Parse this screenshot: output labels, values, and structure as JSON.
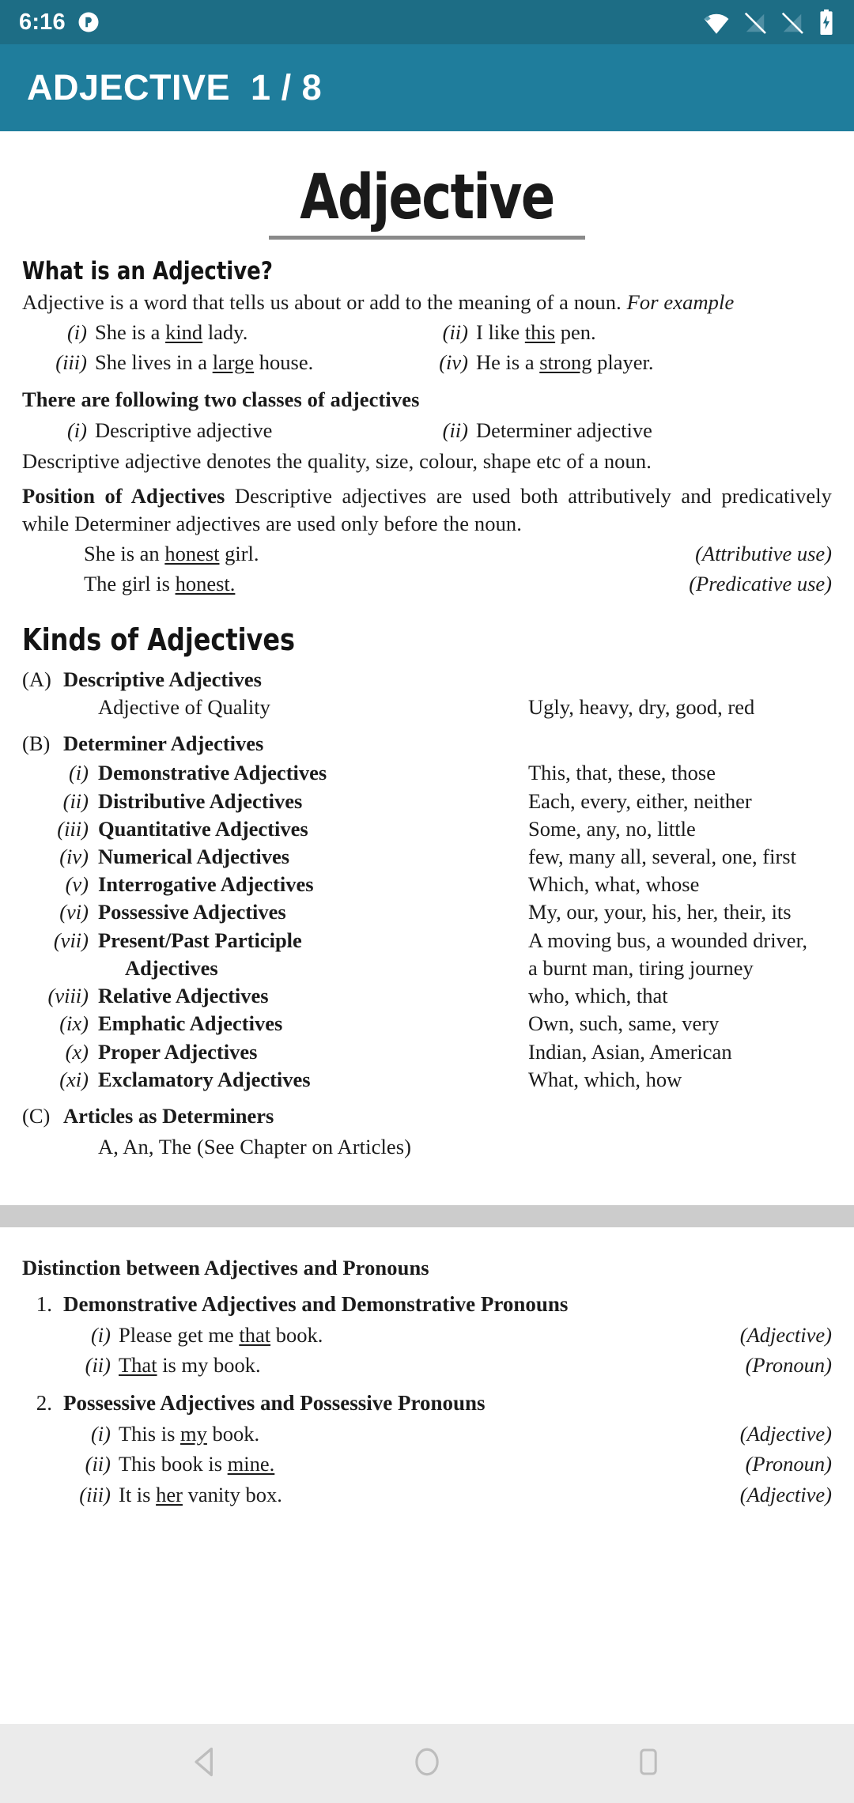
{
  "status_bar": {
    "time": "6:16",
    "icons": [
      "do-not-disturb-icon",
      "wifi-icon",
      "no-sim-1-icon",
      "no-sim-2-icon",
      "battery-charging-icon"
    ],
    "background_color": "#1d6d85"
  },
  "app_bar": {
    "title": "ADJECTIVE  1 / 8",
    "background_color": "#1f7d9c"
  },
  "document": {
    "title": "Adjective",
    "section_what_is": {
      "heading": "What is an Adjective?",
      "intro_plain": "Adjective is a word that tells us about or add to the meaning of a noun. ",
      "intro_italic": "For example",
      "examples": [
        {
          "num": "(i)",
          "pre": "She is a ",
          "u": "kind",
          "post": " lady."
        },
        {
          "num": "(ii)",
          "pre": "I like ",
          "u": "this",
          "post": " pen."
        },
        {
          "num": "(iii)",
          "pre": "She lives in a ",
          "u": "large",
          "post": " house."
        },
        {
          "num": "(iv)",
          "pre": "He is a ",
          "u": "strong",
          "post": " player."
        }
      ]
    },
    "section_classes": {
      "heading": "There are following two classes of adjectives",
      "items": [
        {
          "num": "(i)",
          "text": "Descriptive adjective"
        },
        {
          "num": "(ii)",
          "text": "Determiner adjective"
        }
      ],
      "note": "Descriptive adjective denotes the quality, size, colour, shape etc of a noun."
    },
    "section_position": {
      "lead": "Position of Adjectives",
      "body": " Descriptive adjectives are used both attributively and predicatively while Determiner adjectives are used only before the noun.",
      "examples": [
        {
          "pre": "She is an ",
          "u": "honest",
          "post": " girl.",
          "tag": "(Attributive use)"
        },
        {
          "pre": "The girl is ",
          "u": "honest.",
          "post": "",
          "tag": "(Predicative use)"
        }
      ]
    },
    "section_kinds": {
      "heading": "Kinds of Adjectives",
      "group_a": {
        "letter": "(A)",
        "title": "Descriptive Adjectives",
        "rows": [
          {
            "label": "Adjective of Quality",
            "examples": "Ugly, heavy, dry, good, red"
          }
        ]
      },
      "group_b": {
        "letter": "(B)",
        "title": "Determiner Adjectives",
        "rows": [
          {
            "num": "(i)",
            "label": "Demonstrative Adjectives",
            "examples": "This, that, these, those"
          },
          {
            "num": "(ii)",
            "label": "Distributive Adjectives",
            "examples": "Each, every, either, neither"
          },
          {
            "num": "(iii)",
            "label": "Quantitative Adjectives",
            "examples": "Some, any, no, little"
          },
          {
            "num": "(iv)",
            "label": "Numerical Adjectives",
            "examples": "few, many all, several, one, first"
          },
          {
            "num": "(v)",
            "label": "Interrogative Adjectives",
            "examples": "Which, what, whose"
          },
          {
            "num": "(vi)",
            "label": "Possessive Adjectives",
            "examples": "My, our, your, his, her, their, its"
          },
          {
            "num": "(vii)",
            "label": "Present/Past Participle",
            "examples": "A moving bus, a wounded driver,"
          },
          {
            "num": "",
            "label": "Adjectives",
            "examples": "a burnt man, tiring journey"
          },
          {
            "num": "(viii)",
            "label": "Relative Adjectives",
            "examples": "who, which, that"
          },
          {
            "num": "(ix)",
            "label": "Emphatic Adjectives",
            "examples": "Own, such, same, very"
          },
          {
            "num": "(x)",
            "label": "Proper Adjectives",
            "examples": "Indian, Asian, American"
          },
          {
            "num": "(xi)",
            "label": "Exclamatory Adjectives",
            "examples": "What, which, how"
          }
        ]
      },
      "group_c": {
        "letter": "(C)",
        "title": "Articles as Determiners",
        "note": "A, An, The (See Chapter on Articles)"
      }
    },
    "section_distinction": {
      "heading": "Distinction between Adjectives and Pronouns",
      "groups": [
        {
          "num": "1.",
          "title": "Demonstrative Adjectives and Demonstrative Pronouns",
          "items": [
            {
              "num": "(i)",
              "pre": "Please get me ",
              "u": "that",
              "post": " book.",
              "tag": "(Adjective)"
            },
            {
              "num": "(ii)",
              "pre": "",
              "u": "That",
              "post": " is my book.",
              "tag": "(Pronoun)"
            }
          ]
        },
        {
          "num": "2.",
          "title": "Possessive Adjectives and Possessive Pronouns",
          "items": [
            {
              "num": "(i)",
              "pre": "This is ",
              "u": "my",
              "post": " book.",
              "tag": "(Adjective)"
            },
            {
              "num": "(ii)",
              "pre": "This book is ",
              "u": "mine.",
              "post": "",
              "tag": "(Pronoun)"
            },
            {
              "num": "(iii)",
              "pre": "It is ",
              "u": "her",
              "post": " vanity box.",
              "tag": "(Adjective)"
            }
          ]
        }
      ]
    }
  },
  "nav_bar": {
    "buttons": [
      "back-icon",
      "home-icon",
      "recents-icon"
    ],
    "background_color": "#ebebeb"
  }
}
